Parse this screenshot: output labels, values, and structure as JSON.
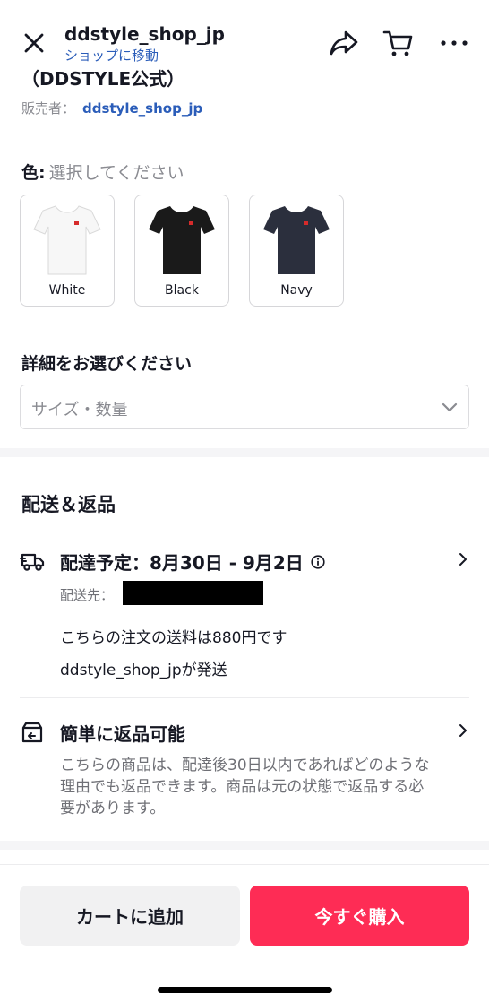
{
  "header": {
    "shop_name": "ddstyle_shop_jp",
    "shop_link": "ショップに移動",
    "shop_subtitle": "（DDSTYLE公式）",
    "icons": {
      "close": "close-icon",
      "share": "share-icon",
      "cart": "cart-icon",
      "more": "more-icon"
    }
  },
  "seller": {
    "label": "販売者：",
    "value": "ddstyle_shop_jp"
  },
  "color_selector": {
    "label": "色:",
    "prompt": "選択してください",
    "options": [
      {
        "label": "White",
        "color": "#f7f7f7"
      },
      {
        "label": "Black",
        "color": "#1a1a1a"
      },
      {
        "label": "Navy",
        "color": "#2b2f3d"
      }
    ]
  },
  "details": {
    "title": "詳細をお選びください",
    "select_placeholder": "サイズ・数量"
  },
  "shipping": {
    "title": "配送＆返品",
    "delivery_title": "配達予定：8月30日 - 9月2日",
    "destination_label": "配送先：",
    "fee_text": "こちらの注文の送料は880円です",
    "shipper_text": "ddstyle_shop_jpが発送",
    "return_title": "簡単に返品可能",
    "return_desc": "こちらの商品は、配達後30日以内であればどのような理由でも返品できます。商品は元の状態で返品する必要があります。"
  },
  "actions": {
    "add_to_cart": "カートに追加",
    "buy_now": "今すぐ購入"
  },
  "colors": {
    "accent": "#fe2c55",
    "link": "#2b5db9",
    "muted": "#8a8b91"
  }
}
